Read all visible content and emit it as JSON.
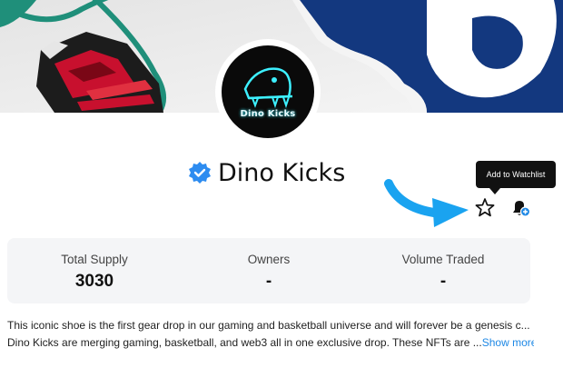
{
  "collection": {
    "logo_text": "Dino Kicks",
    "title": "Dino Kicks",
    "verified": true
  },
  "tooltip": {
    "text": "Add to Watchlist"
  },
  "actions": {
    "watchlist_icon": "star-outline-icon",
    "notify_icon": "bell-plus-icon"
  },
  "stats": [
    {
      "label": "Total Supply",
      "value": "3030"
    },
    {
      "label": "Owners",
      "value": "-"
    },
    {
      "label": "Volume Traded",
      "value": "-"
    }
  ],
  "description": {
    "line1": "This iconic shoe is the first gear drop in our gaming and basketball universe and will forever be a genesis c...",
    "line2": "Dino Kicks are merging gaming, basketball, and web3 all in one exclusive drop. These NFTs are ...",
    "show_more": "Show more"
  },
  "colors": {
    "accent": "#1e88e5",
    "verified": "#2d8cf0",
    "arrow": "#1aa3f0",
    "banner_teal": "#1f8f7a",
    "banner_red": "#c8102e",
    "banner_navy": "#13387f"
  }
}
